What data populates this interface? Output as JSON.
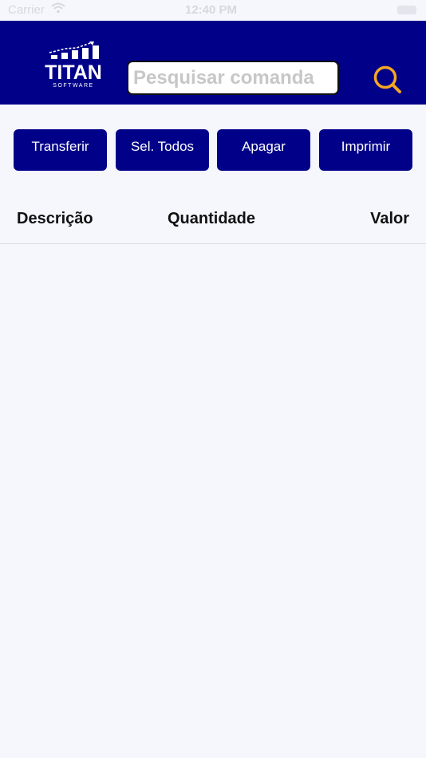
{
  "status_bar": {
    "carrier": "Carrier",
    "time": "12:40 PM"
  },
  "header": {
    "logo_text": "TITAN",
    "logo_subtext": "SOFTWARE",
    "search_placeholder": "Pesquisar comanda",
    "search_value": ""
  },
  "actions": [
    "Transferir",
    "Sel. Todos",
    "Apagar",
    "Imprimir"
  ],
  "table": {
    "columns": [
      "Descrição",
      "Quantidade",
      "Valor"
    ],
    "rows": []
  },
  "colors": {
    "primary": "#010089",
    "accent": "#f5a623",
    "background": "#f6f7fc"
  }
}
